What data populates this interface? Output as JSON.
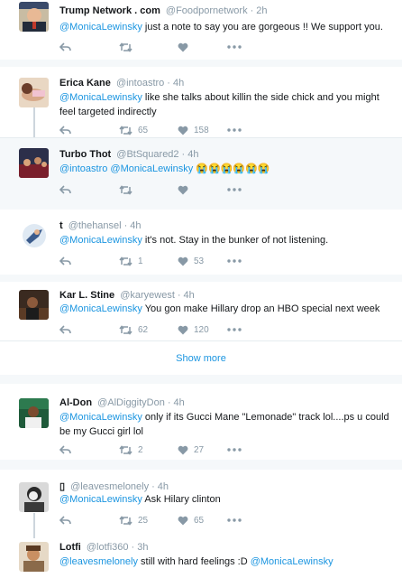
{
  "tweets": [
    {
      "name": "Trump Network . com",
      "handle": "@Foodpornetwork",
      "time": "2h",
      "reply_to": "@MonicaLewinsky",
      "text": " just a note to say you are gorgeous !! We support you.",
      "retweets": "",
      "likes": ""
    },
    {
      "name": "Erica Kane",
      "handle": "@intoastro",
      "time": "4h",
      "reply_to": "@MonicaLewinsky",
      "text": " like she talks about killin the side chick and you might feel targeted indirectly",
      "retweets": "65",
      "likes": "158"
    },
    {
      "name": "Turbo Thot",
      "handle": "@BtSquared2",
      "time": "4h",
      "reply_to": "@intoastro @MonicaLewinsky",
      "text": " 😭😭😭😭😭😭",
      "retweets": "",
      "likes": ""
    },
    {
      "name": "t",
      "handle": "@thehansel",
      "time": "4h",
      "reply_to": "@MonicaLewinsky",
      "text": " it's not. Stay in the bunker of not listening.",
      "retweets": "1",
      "likes": "53"
    },
    {
      "name": "Kar L. Stine",
      "handle": "@karyewest",
      "time": "4h",
      "reply_to": "@MonicaLewinsky",
      "text": " You gon make Hillary drop an HBO special next week",
      "retweets": "62",
      "likes": "120"
    },
    {
      "name": "Al-Don",
      "handle": "@AlDiggityDon",
      "time": "4h",
      "reply_to": "@MonicaLewinsky",
      "text": " only if its Gucci Mane \"Lemonade\" track lol....ps u could be my Gucci girl lol",
      "retweets": "2",
      "likes": "27"
    },
    {
      "name": "▯",
      "handle": "@leavesmelonely",
      "time": "4h",
      "reply_to": "@MonicaLewinsky",
      "text": " Ask Hilary clinton",
      "retweets": "25",
      "likes": "65"
    },
    {
      "name": "Lotfi",
      "handle": "@lotfi360",
      "time": "3h",
      "reply_to": "@leavesmelonely",
      "text": " still with hard feelings :D ",
      "text_mention": "@MonicaLewinsky",
      "retweets": "",
      "likes": ""
    }
  ],
  "show_more": "Show more",
  "colors": {
    "link": "#1b95e0",
    "muted": "#8899a6",
    "bg": "#f5f8fa",
    "border": "#e6ecf0"
  }
}
